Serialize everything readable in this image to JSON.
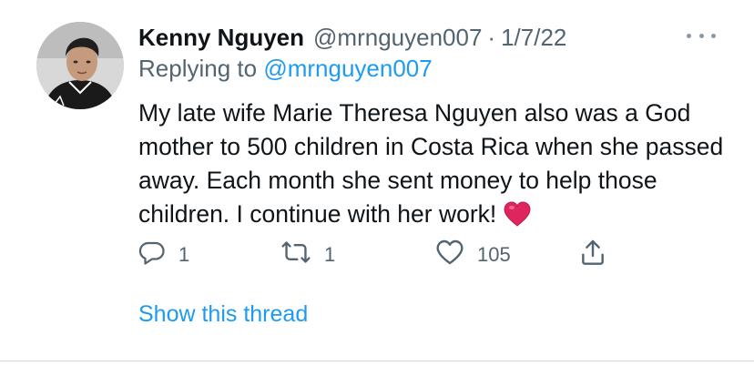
{
  "tweet": {
    "author": {
      "display_name": "Kenny Nguyen",
      "handle": "@mrnguyen007"
    },
    "separator": "·",
    "date": "1/7/22",
    "replying_prefix": "Replying to",
    "replying_to": "@mrnguyen007",
    "text": "My late wife Marie Theresa Nguyen also was a God mother to 500 children in Costa Rica when she passed away. Each month she sent money to help those children. I continue with her work!",
    "emoji": "red-heart-emoji",
    "actions": {
      "reply_count": "1",
      "retweet_count": "1",
      "like_count": "105"
    },
    "show_thread_label": "Show this thread"
  },
  "icons": {
    "more": "more-horizontal-icon",
    "reply": "reply-icon",
    "retweet": "retweet-icon",
    "like": "heart-outline-icon",
    "share": "share-icon"
  },
  "colors": {
    "accent": "#1d9bf0",
    "secondary_text": "#536471",
    "primary_text": "#0f1419",
    "heart_emoji": "#e0245e"
  }
}
